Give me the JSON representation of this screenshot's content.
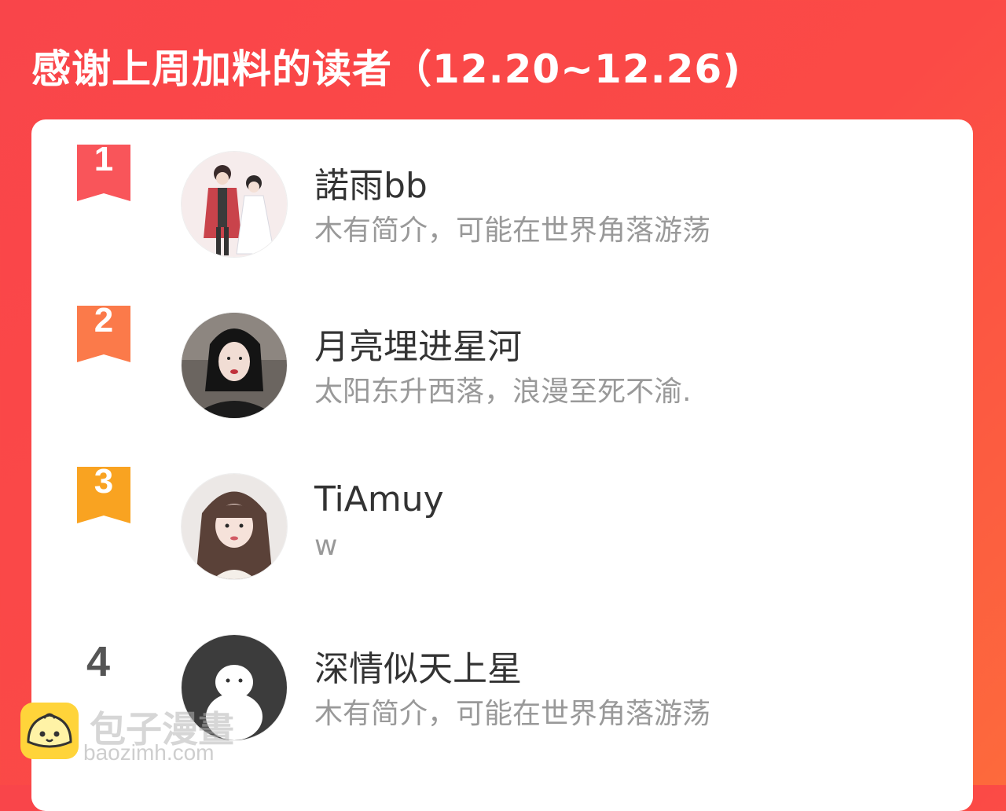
{
  "header": {
    "title": "感谢上周加料的读者（12.20~12.26)"
  },
  "readers": [
    {
      "rank": "1",
      "name": "諾雨bb",
      "bio": "木有简介，可能在世界角落游荡",
      "badge_color": "#f9555a"
    },
    {
      "rank": "2",
      "name": "月亮埋进星河",
      "bio": "太阳东升西落，浪漫至死不渝.",
      "badge_color": "#fb7a4a"
    },
    {
      "rank": "3",
      "name": "TiAmuy",
      "bio": "w",
      "badge_color": "#f9a321"
    },
    {
      "rank": "4",
      "name": "深情似天上星",
      "bio": "木有简介，可能在世界角落游荡"
    }
  ],
  "watermark": {
    "brand": "包子漫畫",
    "url": "baozimh.com"
  },
  "colors": {
    "background": "#f9454a",
    "card": "#ffffff",
    "name_text": "#333333",
    "bio_text": "#999999"
  }
}
